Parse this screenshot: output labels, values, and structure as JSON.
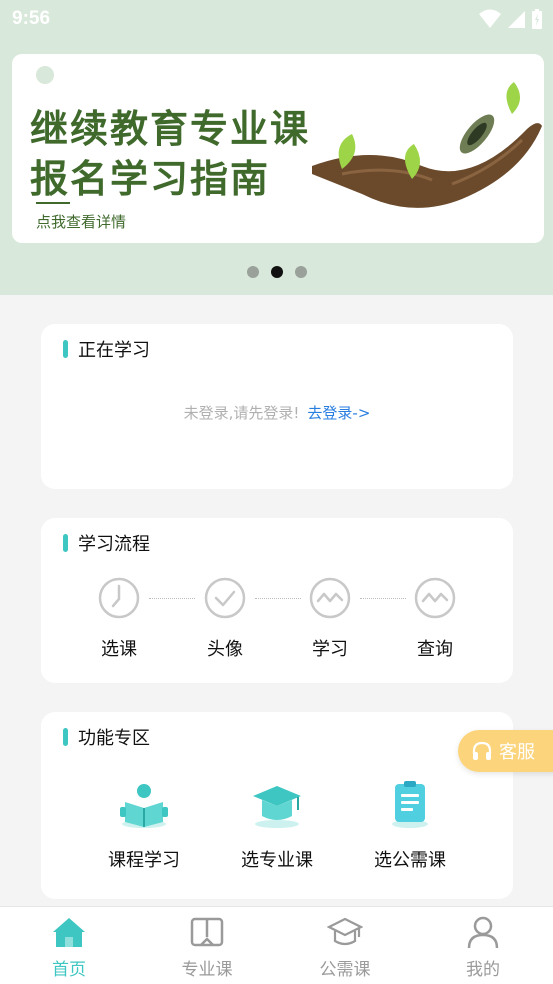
{
  "status_bar": {
    "time": "9:56"
  },
  "banner": {
    "title_line1": "继续教育专业课",
    "title_line2": "报名学习指南",
    "subtitle": "点我查看详情",
    "active_slide": 2,
    "slide_count": 3
  },
  "studying": {
    "title": "正在学习",
    "not_logged_text": "未登录,请先登录!",
    "login_link": "去登录->"
  },
  "flow": {
    "title": "学习流程",
    "steps": [
      {
        "label": "选课",
        "icon": "clock-icon"
      },
      {
        "label": "头像",
        "icon": "check-circle-icon"
      },
      {
        "label": "学习",
        "icon": "wave-circle-icon"
      },
      {
        "label": "查询",
        "icon": "wave-circle-icon"
      }
    ]
  },
  "functions": {
    "title": "功能专区",
    "items": [
      {
        "label": "课程学习",
        "icon": "reading-person-icon"
      },
      {
        "label": "选专业课",
        "icon": "graduation-cap-icon"
      },
      {
        "label": "选公需课",
        "icon": "document-list-icon"
      }
    ]
  },
  "kefu": {
    "label": "客服"
  },
  "tabs": [
    {
      "label": "首页",
      "icon": "home-icon",
      "active": true
    },
    {
      "label": "专业课",
      "icon": "book-icon",
      "active": false
    },
    {
      "label": "公需课",
      "icon": "graduation-cap-icon",
      "active": false
    },
    {
      "label": "我的",
      "icon": "person-icon",
      "active": false
    }
  ],
  "colors": {
    "accent": "#3ec6c2",
    "header_bg": "#d8e8da",
    "banner_text": "#3f6a2c",
    "link": "#2a7ee0",
    "kefu_bg": "#fcd47c"
  }
}
